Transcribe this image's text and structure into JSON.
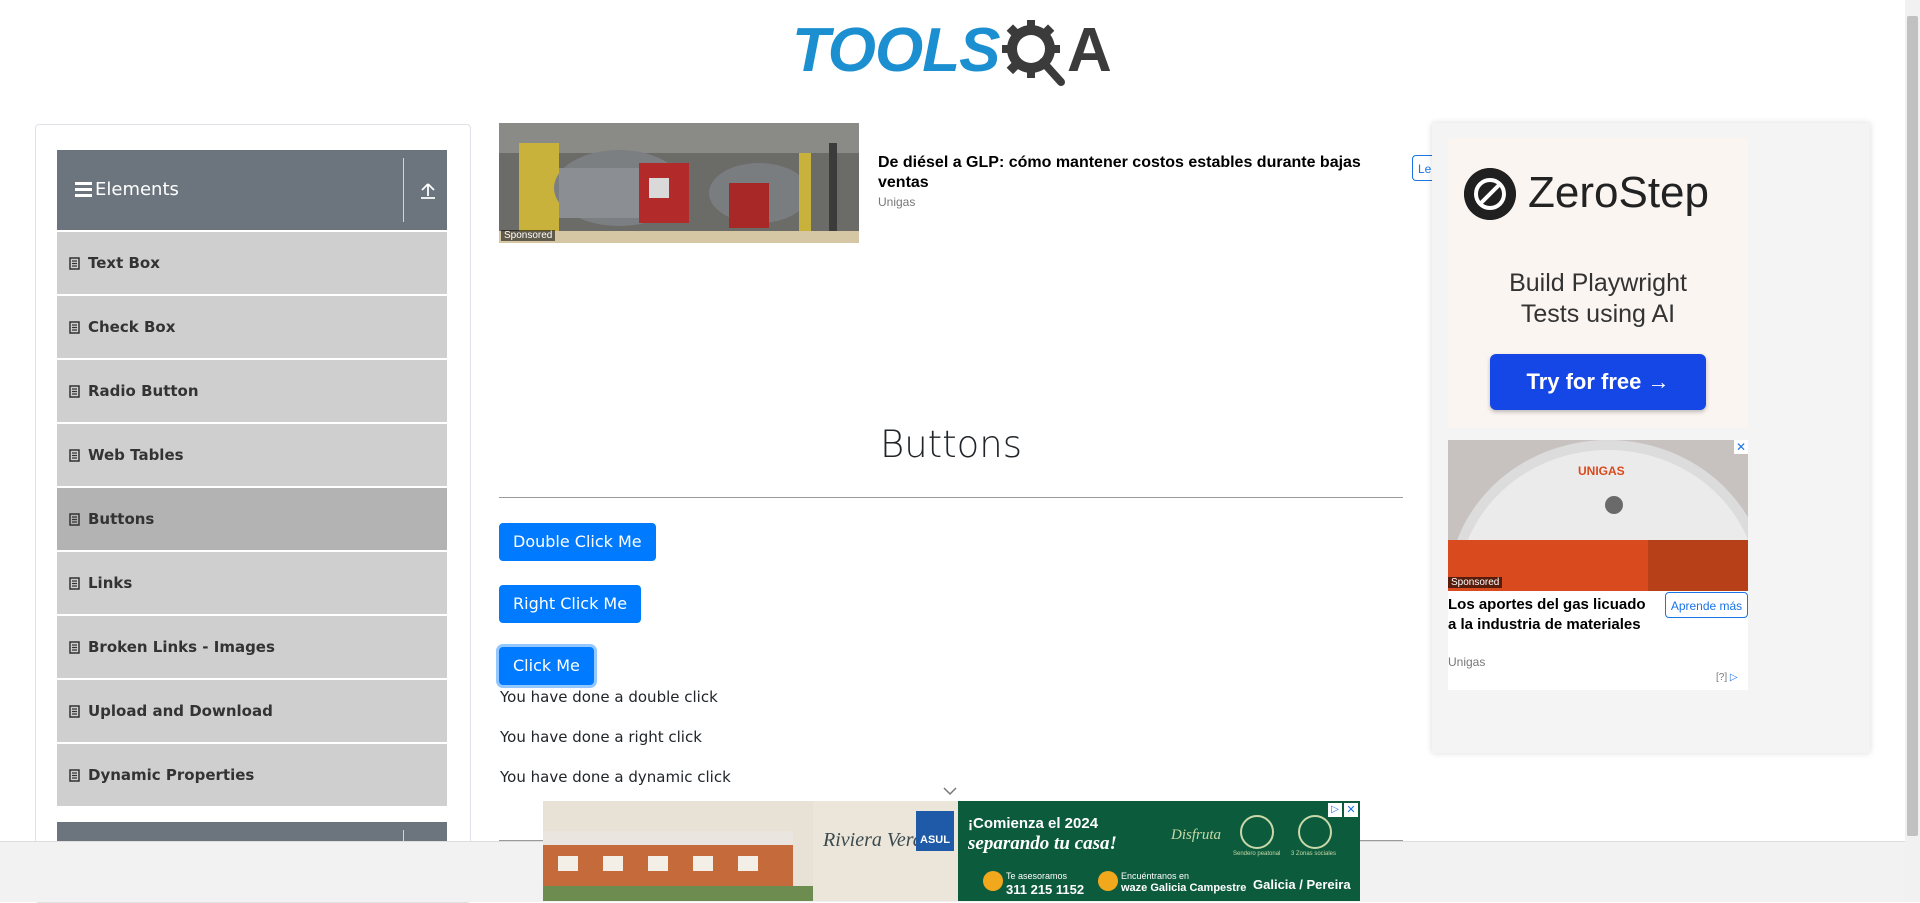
{
  "header": {
    "logo_part1": "TOOLS",
    "logo_part2": "A"
  },
  "sidebar": {
    "group_title": "Elements",
    "items": [
      {
        "label": "Text Box"
      },
      {
        "label": "Check Box"
      },
      {
        "label": "Radio Button"
      },
      {
        "label": "Web Tables"
      },
      {
        "label": "Buttons",
        "active": true
      },
      {
        "label": "Links"
      },
      {
        "label": "Broken Links - Images"
      },
      {
        "label": "Upload and Download"
      },
      {
        "label": "Dynamic Properties"
      }
    ]
  },
  "ad_top": {
    "sponsored": "Sponsored",
    "headline": "De diésel a GLP: cómo mantener costos estables durante bajas ventas",
    "brand": "Unigas",
    "cta_partial": "Le"
  },
  "main": {
    "title": "Buttons",
    "buttons": {
      "double": "Double Click Me",
      "right": "Right Click Me",
      "click": "Click Me"
    },
    "messages": {
      "double": "You have done a double click",
      "right": "You have done a right click",
      "dynamic": "You have done a dynamic click"
    }
  },
  "ad_right": {
    "zerostep_name": "ZeroStep",
    "zerostep_tagline_1": "Build Playwright",
    "zerostep_tagline_2": "Tests using AI",
    "zerostep_cta": "Try for free →",
    "unigas_sponsored": "Sponsored",
    "unigas_headline": "Los aportes del gas licuado a la industria de materiales",
    "unigas_brand": "Unigas",
    "unigas_cta": "Aprende más",
    "unigas_info": "[?]",
    "unigas_logo_text": "UNIGAS"
  },
  "ad_bottom": {
    "brand": "Riviera Verde",
    "asul": "ASUL",
    "headline_1": "¡Comienza el 2024",
    "headline_2": "separando tu casa!",
    "disfruta": "Disfruta",
    "cap_1": "Sendero peatonal",
    "cap_2": "3 Zonas sociales",
    "phone_label": "Te asesoramos",
    "phone": "311 215 1152",
    "waze_label": "Encuéntranos en",
    "waze": "waze Galicia Campestre",
    "city": "Galicia / Pereira"
  },
  "colors": {
    "primary": "#007bff",
    "sidebar_header": "#6c757d",
    "menu_item": "#cfcfcf",
    "menu_item_active": "#b3b3b3",
    "logo_blue": "#1b8fd0",
    "zerostep_blue": "#1546e6"
  },
  "icons": {
    "hamburger": "hamburger-icon",
    "collapse": "collapse-up-icon",
    "menu_item": "document-icon",
    "chevron": "chevron-down-icon"
  }
}
